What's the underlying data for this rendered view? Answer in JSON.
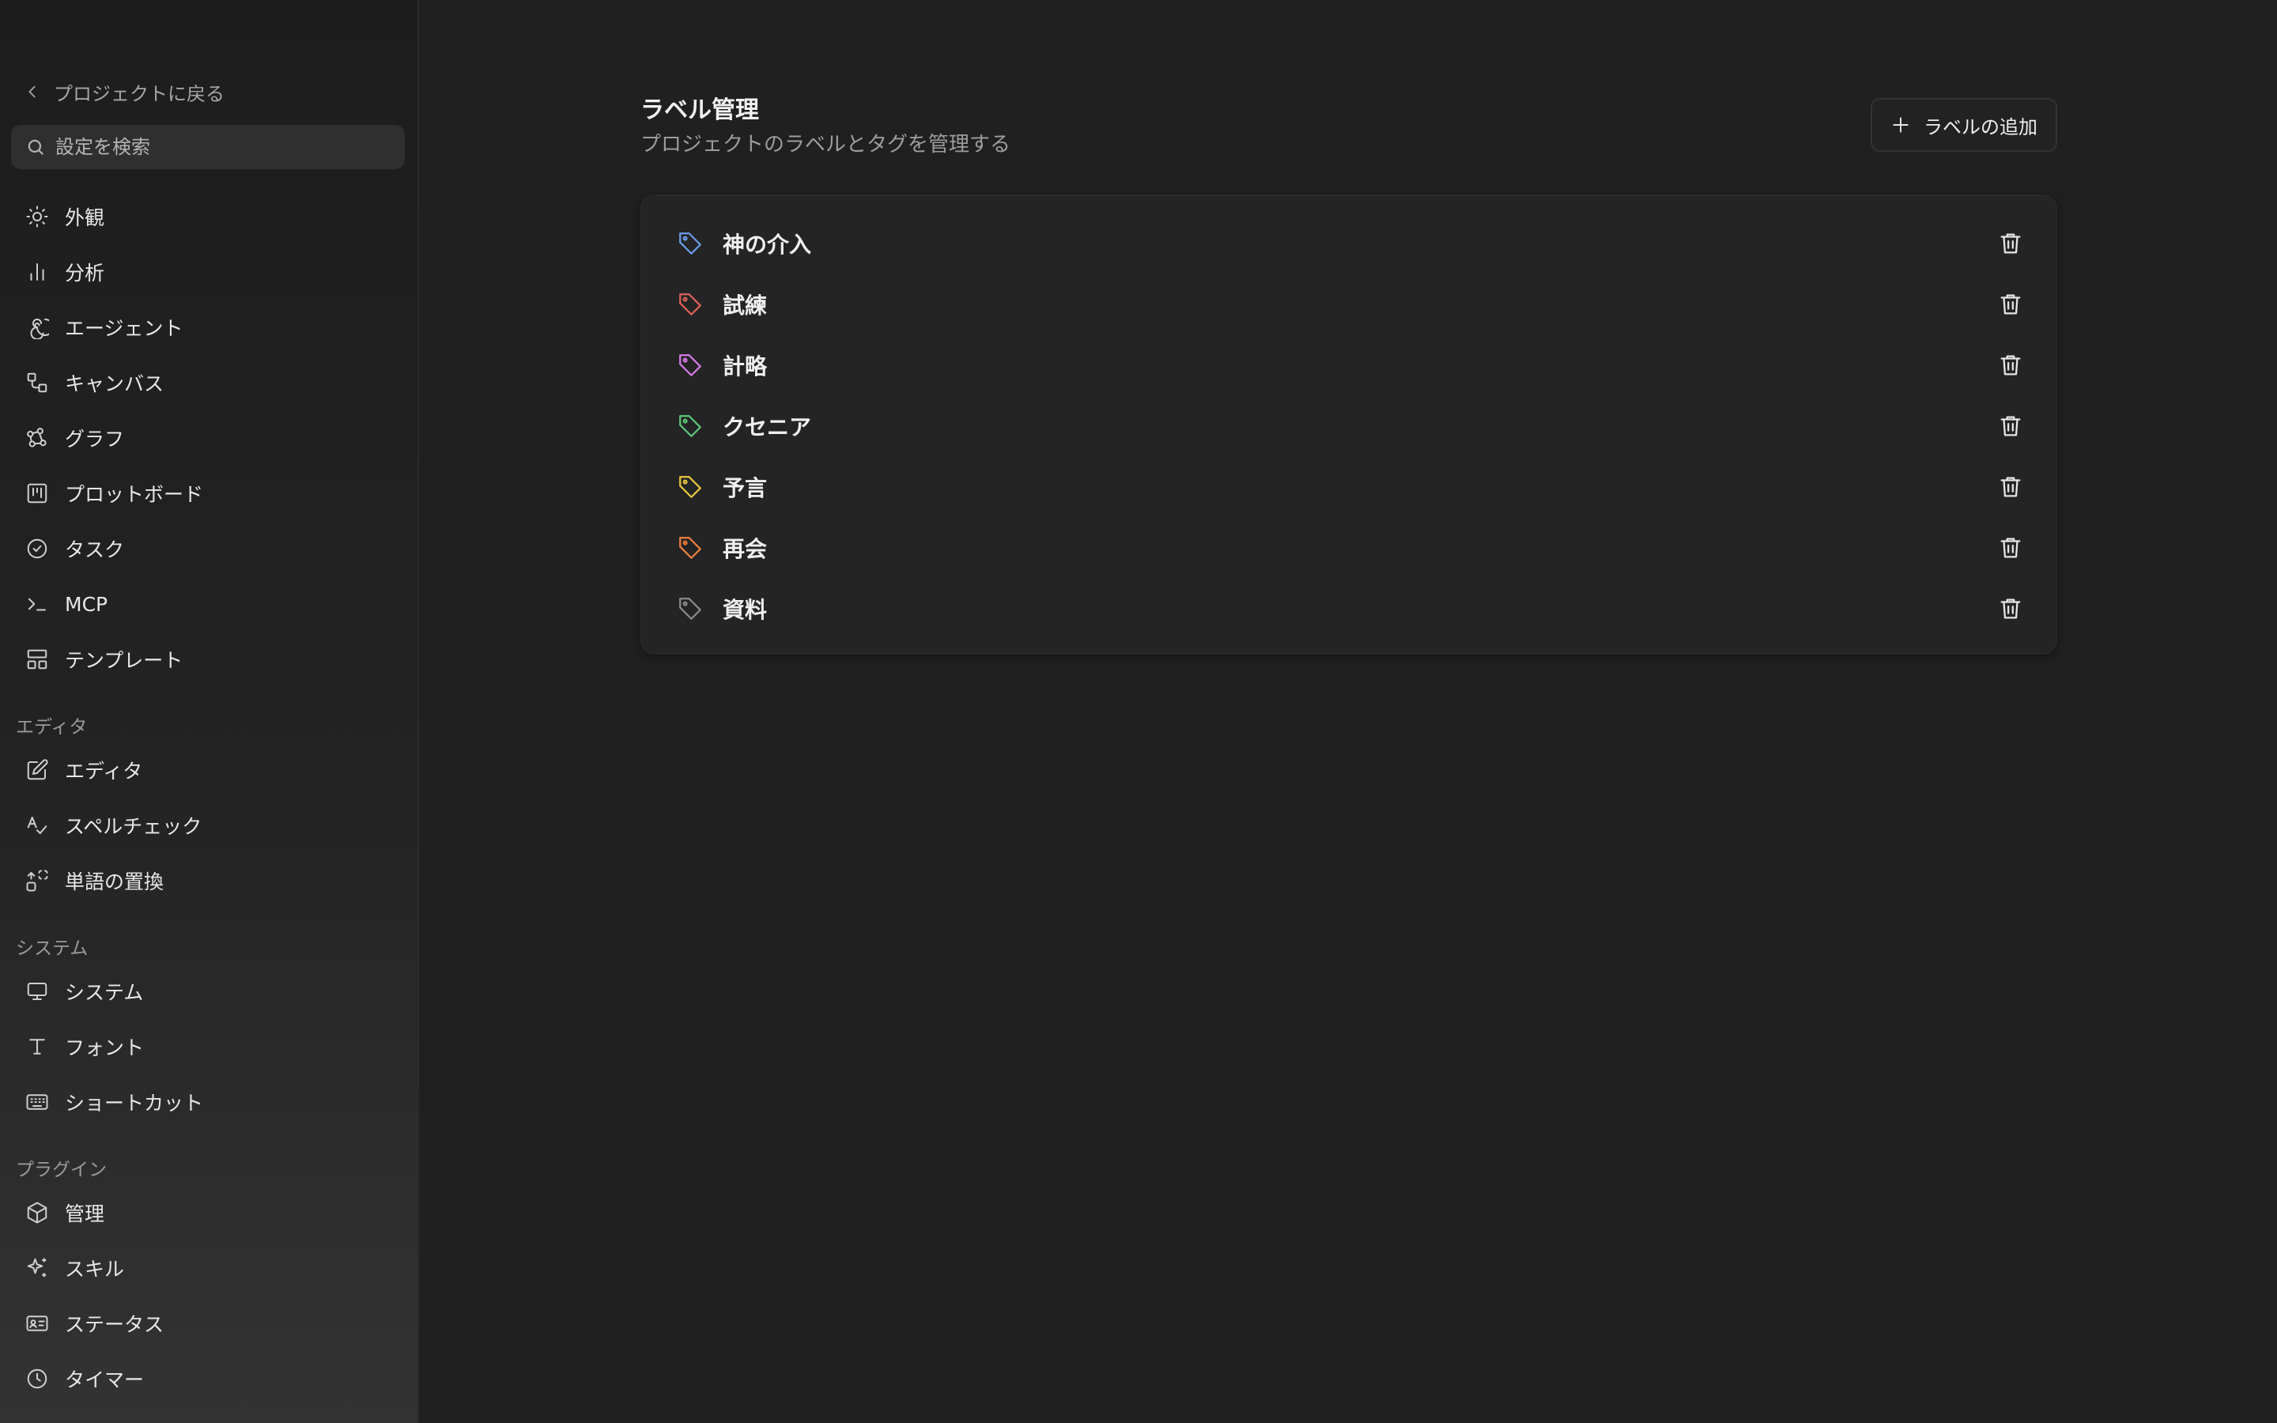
{
  "sidebar": {
    "back_label": "プロジェクトに戻る",
    "search_placeholder": "設定を検索",
    "items": [
      {
        "label": "外観",
        "icon": "sun-icon"
      },
      {
        "label": "分析",
        "icon": "bar-chart-icon"
      },
      {
        "label": "エージェント",
        "icon": "spiral-icon"
      },
      {
        "label": "キャンバス",
        "icon": "canvas-icon"
      },
      {
        "label": "グラフ",
        "icon": "graph-icon"
      },
      {
        "label": "プロットボード",
        "icon": "kanban-icon"
      },
      {
        "label": "タスク",
        "icon": "check-circle-icon"
      },
      {
        "label": "MCP",
        "icon": "terminal-icon"
      },
      {
        "label": "テンプレート",
        "icon": "layout-icon"
      }
    ],
    "sections": [
      {
        "title": "エディタ",
        "items": [
          {
            "label": "エディタ",
            "icon": "edit-icon"
          },
          {
            "label": "スペルチェック",
            "icon": "spellcheck-icon"
          },
          {
            "label": "単語の置換",
            "icon": "replace-icon"
          }
        ]
      },
      {
        "title": "システム",
        "items": [
          {
            "label": "システム",
            "icon": "monitor-icon"
          },
          {
            "label": "フォント",
            "icon": "type-icon"
          },
          {
            "label": "ショートカット",
            "icon": "keyboard-icon"
          }
        ]
      },
      {
        "title": "プラグイン",
        "items": [
          {
            "label": "管理",
            "icon": "package-icon"
          },
          {
            "label": "スキル",
            "icon": "sparkle-icon"
          },
          {
            "label": "ステータス",
            "icon": "id-card-icon"
          },
          {
            "label": "タイマー",
            "icon": "clock-icon"
          }
        ]
      }
    ]
  },
  "main": {
    "title": "ラベル管理",
    "subtitle": "プロジェクトのラベルとタグを管理する",
    "add_button_label": "ラベルの追加",
    "labels": [
      {
        "name": "神の介入",
        "color": "#6b9be8"
      },
      {
        "name": "試練",
        "color": "#e0605a"
      },
      {
        "name": "計略",
        "color": "#d27ae6"
      },
      {
        "name": "クセニア",
        "color": "#5cc777"
      },
      {
        "name": "予言",
        "color": "#e8c542"
      },
      {
        "name": "再会",
        "color": "#ef7e3f"
      },
      {
        "name": "資料",
        "color": "#8a8a8a"
      }
    ]
  }
}
